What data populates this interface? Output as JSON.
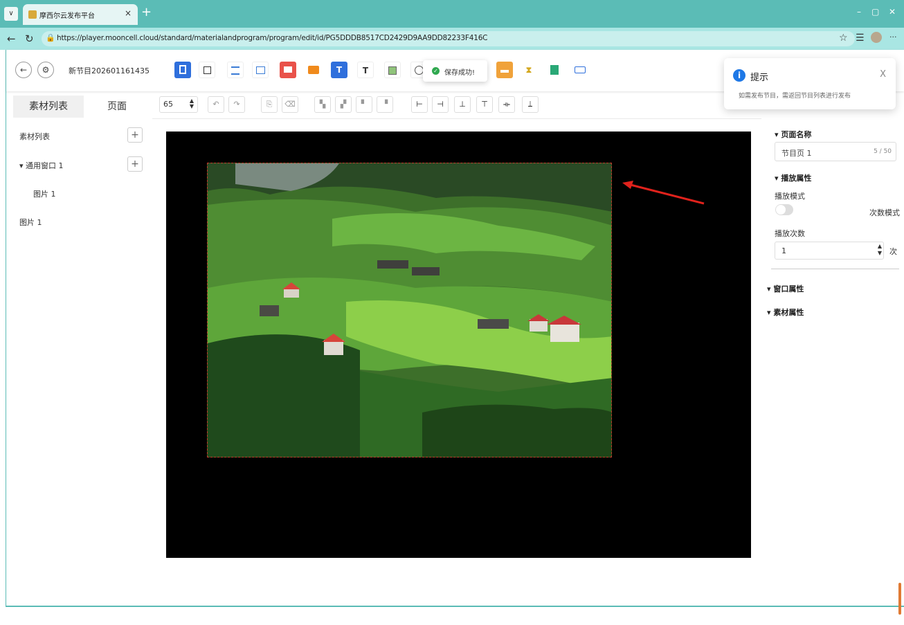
{
  "browser": {
    "tab_title": "摩西尔云发布平台",
    "tab_close": "×",
    "new_tab": "+",
    "url": "https://player.mooncell.cloud/standard/materialandprogram/program/edit/id/PG5DDDB8517CD2429D9AA9DD82233F416C",
    "dropdown_glyph": "∨",
    "back_glyph": "←",
    "reload_glyph": "↻",
    "lock_glyph": "🔒",
    "star_glyph": "☆",
    "favorites_glyph": "☰",
    "more_glyph": "···",
    "minimize_glyph": "–",
    "restore_glyph": "▢",
    "close_glyph": "✕"
  },
  "header": {
    "back_glyph": "←",
    "settings_glyph": "⚙",
    "program_name": "新节目202601161435"
  },
  "toast": {
    "message": "保存成功!",
    "check_glyph": "✓"
  },
  "notification": {
    "title": "提示",
    "message": "如需发布节目，需返回节目列表进行发布",
    "info_glyph": "i",
    "close_glyph": "X"
  },
  "left_panel": {
    "tabs": [
      {
        "label": "素材列表"
      },
      {
        "label": "页面"
      }
    ],
    "tree": [
      {
        "label": "素材列表"
      },
      {
        "label": "▾ 通用窗口 1"
      },
      {
        "label": "图片 1"
      },
      {
        "label": "图片 1"
      }
    ],
    "plus_glyph": "+"
  },
  "edit_toolbar": {
    "zoom_value": "65"
  },
  "right_panel": {
    "page_name_header": "▾ 页面名称",
    "page_name_value": "节目页 1",
    "page_name_counter": "5 / 50",
    "play_header": "▾ 播放属性",
    "play_mode_label": "播放模式",
    "count_mode_label": "次数模式",
    "play_count_label": "播放次数",
    "play_count_value": "1",
    "play_count_unit": "次",
    "window_header": "▾ 窗口属性",
    "material_header": "▾ 素材属性"
  },
  "colors": {
    "chrome_teal": "#5bbcb6",
    "addressbar": "#a9e6e3",
    "canvas_bg": "#000000",
    "success": "#2fa84f",
    "info": "#1e78e6",
    "arrow": "#e0221c"
  }
}
